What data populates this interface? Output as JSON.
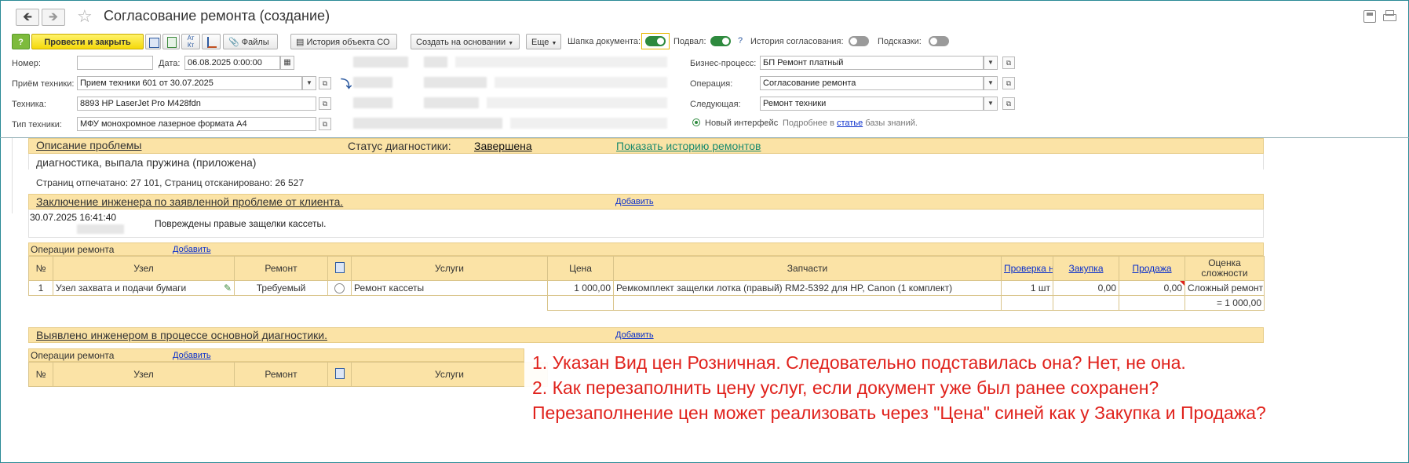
{
  "header": {
    "title": "Согласование ремонта (создание)",
    "back_icon": "arrow-left-icon",
    "forward_icon": "arrow-right-icon",
    "star_icon": "star-icon",
    "save_icon": "save-icon",
    "print_icon": "printer-icon"
  },
  "toolbar": {
    "help_label": "?",
    "post_close_label": "Провести и закрыть",
    "files_label": "Файлы",
    "history_object_label": "История объекта СО",
    "create_basis_label": "Создать на основании",
    "more_label": "Еще",
    "doc_header_label": "Шапка документа:",
    "footer_label": "Подвал:",
    "question_label": "?",
    "approval_history_label": "История согласования:",
    "hints_label": "Подсказки:",
    "doc_header_on": true,
    "footer_on": true,
    "approval_history_on": false,
    "hints_on": false
  },
  "form": {
    "number_label": "Номер:",
    "number_value": "",
    "date_label": "Дата:",
    "date_value": "06.08.2025  0:00:00",
    "reception_label": "Приём техники:",
    "reception_value": "Прием техники 601 от 30.07.2025",
    "equipment_label": "Техника:",
    "equipment_value": "8893 HP LaserJet Pro M428fdn",
    "equipment_type_label": "Тип техники:",
    "equipment_type_value": "МФУ монохромное лазерное формата A4",
    "bp_label": "Бизнес-процесс:",
    "bp_value": "БП Ремонт платный",
    "operation_label": "Операция:",
    "operation_value": "Согласование ремонта",
    "next_label": "Следующая:",
    "next_value": "Ремонт техники",
    "new_interface_label": "Новый интерфейс",
    "kb_prefix": "Подробнее в",
    "kb_link": "статье",
    "kb_suffix": "базы знаний."
  },
  "problem": {
    "title": "Описание проблемы",
    "status_label": "Статус диагностики:",
    "status_value": "Завершена",
    "history_link": "Показать историю ремонтов",
    "description": "диагностика, выпала пружина (приложена)",
    "counters": "Страниц отпечатано: 27 101, Страниц отсканировано: 26 527"
  },
  "conclusion": {
    "title": "Заключение инженера по заявленной проблеме от клиента.",
    "add_link": "Добавить",
    "timestamp": "30.07.2025 16:41:40",
    "text": "Повреждены правые защелки кассеты."
  },
  "repair_ops": {
    "title": "Операции ремонта",
    "add_link": "Добавить",
    "columns": {
      "num": "№",
      "node": "Узел",
      "repair": "Ремонт",
      "services": "Услуги",
      "price": "Цена",
      "parts": "Запчасти",
      "availability": "Проверка наличия",
      "purchase": "Закупка",
      "sale": "Продажа",
      "complexity": "Оценка сложности"
    },
    "rows": [
      {
        "num": "1",
        "node": "Узел захвата и подачи бумаги",
        "repair": "Требуемый",
        "services": "Ремонт кассеты",
        "price": "1 000,00",
        "parts": "Ремкомплект защелки лотка (правый) RM2-5392 для HP, Canon (1 комплект)",
        "availability": "1 шт",
        "purchase": "0,00",
        "sale": "0,00",
        "complexity": "Сложный ремонт"
      }
    ],
    "total": "= 1 000,00"
  },
  "found": {
    "title": "Выявлено инженером в процессе основной диагностики.",
    "add_link": "Добавить",
    "ops_title": "Операции ремонта",
    "ops_add_link": "Добавить",
    "columns": {
      "num": "№",
      "node": "Узел",
      "repair": "Ремонт",
      "services": "Услуги"
    }
  },
  "annotation": {
    "line1": "1. Указан Вид цен Розничная. Следовательно подставилась она? Нет, не она.",
    "line2": "2. Как перезаполнить цену услуг, если документ уже был ранее сохранен?",
    "line3": "Перезаполнение цен может реализовать через \"Цена\" синей как у Закупка и Продажа?",
    "color": "#e0221c"
  },
  "colors": {
    "section_bg": "#fbe3a6",
    "primary_button": "#f5d90a",
    "toggle_on": "#2e8a3e",
    "link": "#0a2fcc"
  }
}
